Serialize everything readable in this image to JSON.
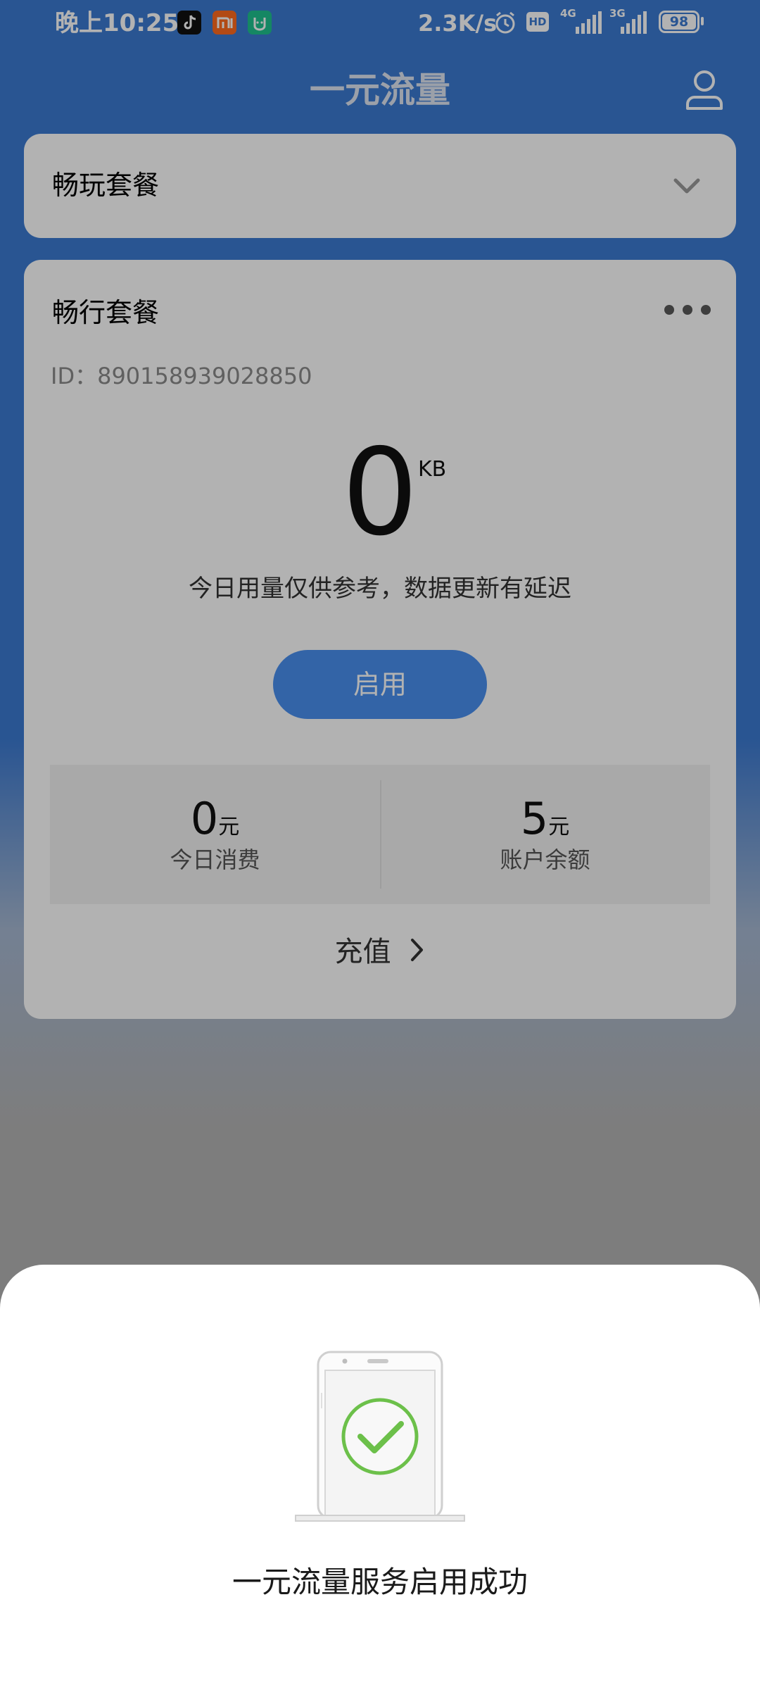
{
  "status_bar": {
    "time": "晚上10:25",
    "net_speed": "2.3K/s",
    "hd_badge": "HD",
    "network_1": "4G",
    "network_2": "3G",
    "battery": "98",
    "app_icons": [
      "douyin-icon",
      "mi-icon",
      "mijia-icon"
    ]
  },
  "header": {
    "title": "一元流量",
    "profile_icon": "person-icon"
  },
  "card_play": {
    "title": "畅玩套餐",
    "toggle_icon": "chevron-down-icon"
  },
  "card_travel": {
    "title": "畅行套餐",
    "more_icon": "more-dots-icon",
    "id_text": "ID：890158939028850",
    "usage_value": "0",
    "usage_unit": "KB",
    "usage_note": "今日用量仅供参考，数据更新有延迟",
    "enable_label": "启用",
    "today_spend": {
      "value": "0",
      "unit": "元",
      "label": "今日消费"
    },
    "balance": {
      "value": "5",
      "unit": "元",
      "label": "账户余额"
    },
    "recharge_label": "充值"
  },
  "sheet": {
    "illustration": "phone-success-check-icon",
    "message": "一元流量服务启用成功"
  },
  "colors": {
    "brand_blue": "#3c7ad2",
    "button_blue": "#4a90f0",
    "success_green": "#6cc04a"
  }
}
